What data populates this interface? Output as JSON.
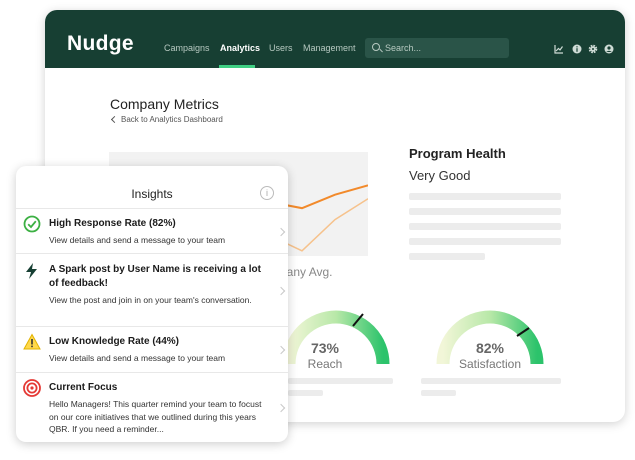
{
  "app": {
    "name": "Nudge"
  },
  "nav": {
    "items": [
      "Campaigns",
      "Analytics",
      "Users",
      "Management"
    ],
    "active": "Analytics"
  },
  "search": {
    "placeholder": "Search..."
  },
  "toolbar_icons": [
    "chart-icon",
    "info-icon",
    "gear-icon",
    "user-icon"
  ],
  "page": {
    "title": "Company Metrics",
    "back_link": "Back to Analytics Dashboard"
  },
  "chart_data": {
    "type": "line",
    "series": [
      {
        "values": [
          0.52,
          0.46,
          0.59,
          0.68
        ],
        "color": "#f28a2b"
      },
      {
        "values": [
          0.2,
          0.05,
          0.35,
          0.55
        ],
        "color": "#f6c28c"
      }
    ],
    "legend_fragment": "mpany Avg."
  },
  "program_health": {
    "title": "Program Health",
    "value": "Very Good"
  },
  "gauges": [
    {
      "value": "73%",
      "label": "Reach",
      "level": 0.73
    },
    {
      "value": "82%",
      "label": "Satisfaction",
      "level": 0.82
    }
  ],
  "insights": {
    "title": "Insights",
    "items": [
      {
        "icon": "check-circle-icon",
        "title": "High Response Rate (82%)",
        "desc": "View details and send a message to your team"
      },
      {
        "icon": "lightning-icon",
        "title": "A Spark post by User Name is receiving a lot of feedback!",
        "desc": "View the post and join in on your team's conversation."
      },
      {
        "icon": "warning-icon",
        "title": "Low Knowledge Rate (44%)",
        "desc": "View details and send a message to your team"
      },
      {
        "icon": "target-icon",
        "title": "Current Focus",
        "desc": "Hello Managers! This quarter remind your team to focust on our core initiatives that we outlined during this years QBR. If you need a reminder..."
      }
    ]
  },
  "colors": {
    "topbar": "#173f33",
    "accent": "#3fcf83",
    "orange": "#f28a2b"
  }
}
